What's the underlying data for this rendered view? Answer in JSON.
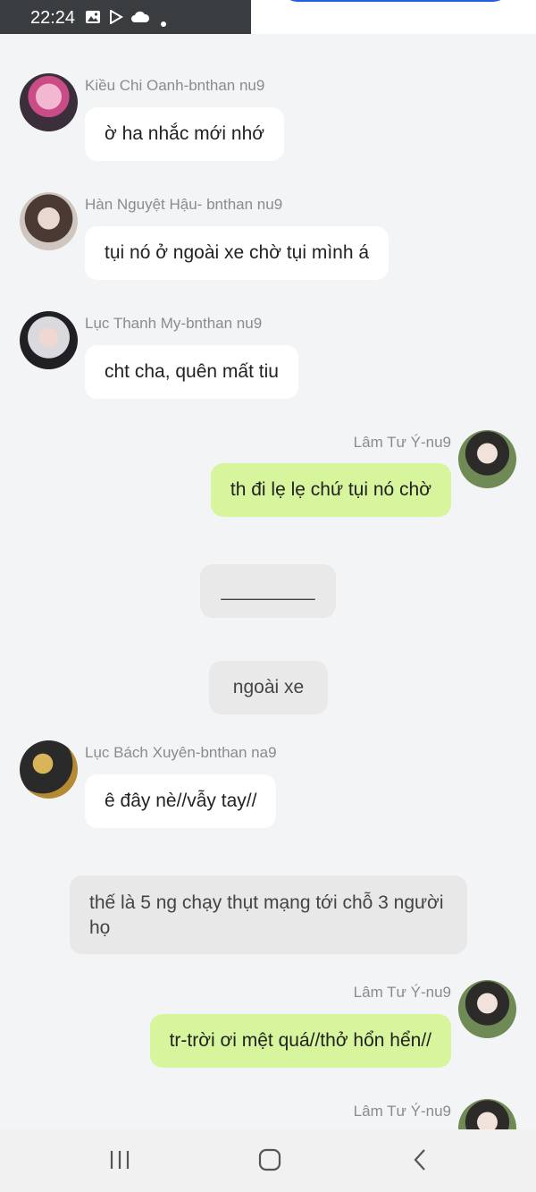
{
  "status_bar": {
    "time": "22:24",
    "icons": [
      "image-icon",
      "play-store-icon",
      "cloud-icon",
      "dot-icon"
    ]
  },
  "messages": [
    {
      "sender": "Kiều Chi Oanh-bnthan nu9",
      "text": "ờ ha nhắc mới nhớ",
      "side": "left"
    },
    {
      "sender": "Hàn Nguyệt Hậu- bnthan nu9",
      "text": "tụi nó ở ngoài xe chờ tụi mình á",
      "side": "left"
    },
    {
      "sender": "Lục Thanh My-bnthan nu9",
      "text": "cht cha, quên mất tiu",
      "side": "left"
    },
    {
      "sender": "Lâm Tư Ý-nu9",
      "text": "th đi lẹ lẹ chứ tụi nó chờ",
      "side": "right"
    },
    {
      "sender": "Lục Bách Xuyên-bnthan na9",
      "text": "ê đây nè//vẫy tay//",
      "side": "left"
    },
    {
      "sender": "Lâm Tư Ý-nu9",
      "text": "tr-trời ơi mệt quá//thở hổn hển//",
      "side": "right"
    },
    {
      "sender": "Lâm Tư Ý-nu9",
      "text": "",
      "side": "right"
    }
  ],
  "system_bubbles": [
    "_________",
    "ngoài xe"
  ],
  "narration": "thế là 5 ng chạy thụt mạng tới chỗ 3 người họ",
  "nav": {
    "buttons": [
      "recent-apps",
      "home",
      "back"
    ]
  },
  "colors": {
    "incoming": "#ffffff",
    "outgoing": "#d7f59c",
    "system": "#e9e9e9",
    "background": "#f3f4f6"
  }
}
